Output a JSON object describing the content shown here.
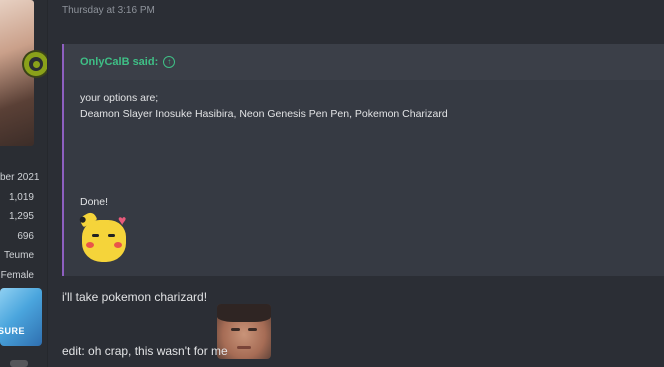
{
  "post": {
    "timestamp": "Thursday at 3:16 PM",
    "author_stats": [
      "ber 2021",
      "1,019",
      "1,295",
      "696",
      "Teume",
      "Female"
    ],
    "banner_text": "SURE"
  },
  "quote": {
    "author_said": "OnlyCalB said:",
    "line1": "your options are;",
    "line2": "Deamon Slayer Inosuke Hasibira, Neon Genesis Pen Pen, Pokemon Charizard",
    "done": "Done!"
  },
  "reply": {
    "line1": "i'll take pokemon charizard!",
    "line2": "edit: oh crap, this wasn't for me"
  },
  "colors": {
    "accent_green": "#3fbf86",
    "quote_border": "#8e5fc0",
    "online": "#8aa11a"
  },
  "icons": [
    "online-status-icon",
    "arrow-up-circle-icon"
  ]
}
